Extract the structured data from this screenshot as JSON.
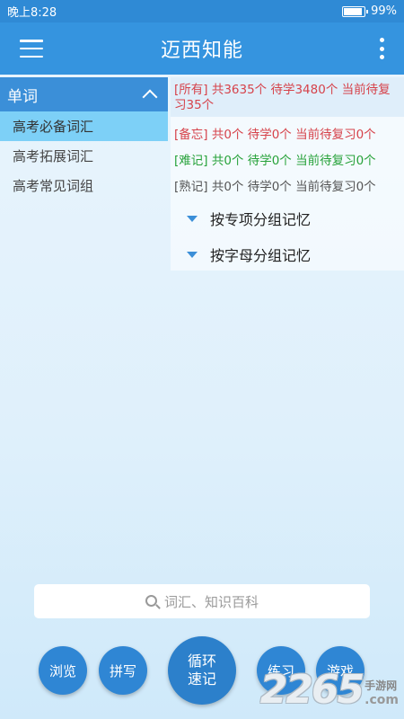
{
  "status_bar": {
    "time": "晚上8:28",
    "battery": "99%"
  },
  "app_bar": {
    "title": "迈西知能",
    "menu_icon": "menu-icon",
    "more_icon": "more-vertical-icon"
  },
  "left_panel": {
    "header": "单词",
    "items": [
      {
        "label": "高考必备词汇",
        "active": true
      },
      {
        "label": "高考拓展词汇",
        "active": false
      },
      {
        "label": "高考常见词组",
        "active": false
      }
    ]
  },
  "right_panel": {
    "stats": {
      "all": "[所有] 共3635个 待学3480个 当前待复习35个",
      "memo": "[备忘] 共0个 待学0个 当前待复习0个",
      "hard": "[难记] 共0个 待学0个 当前待复习0个",
      "known": "[熟记] 共0个 待学0个 当前待复习0个"
    },
    "groups": [
      {
        "label": "按专项分组记忆"
      },
      {
        "label": "按字母分组记忆"
      }
    ]
  },
  "search": {
    "placeholder": "词汇、知识百科"
  },
  "buttons": {
    "browse": "浏览",
    "spell": "拼写",
    "cycle_line1": "循环",
    "cycle_line2": "速记",
    "practice": "练习",
    "game": "游戏"
  },
  "watermark": {
    "number": "2265",
    "cn": "手游网",
    "com": ".com"
  },
  "colors": {
    "status_bar": "#2f8ad5",
    "app_bar": "#3594df",
    "active_item": "#7dd0f7",
    "red_text": "#d6424a",
    "green_text": "#27a23a",
    "button": "#2f86d4"
  }
}
